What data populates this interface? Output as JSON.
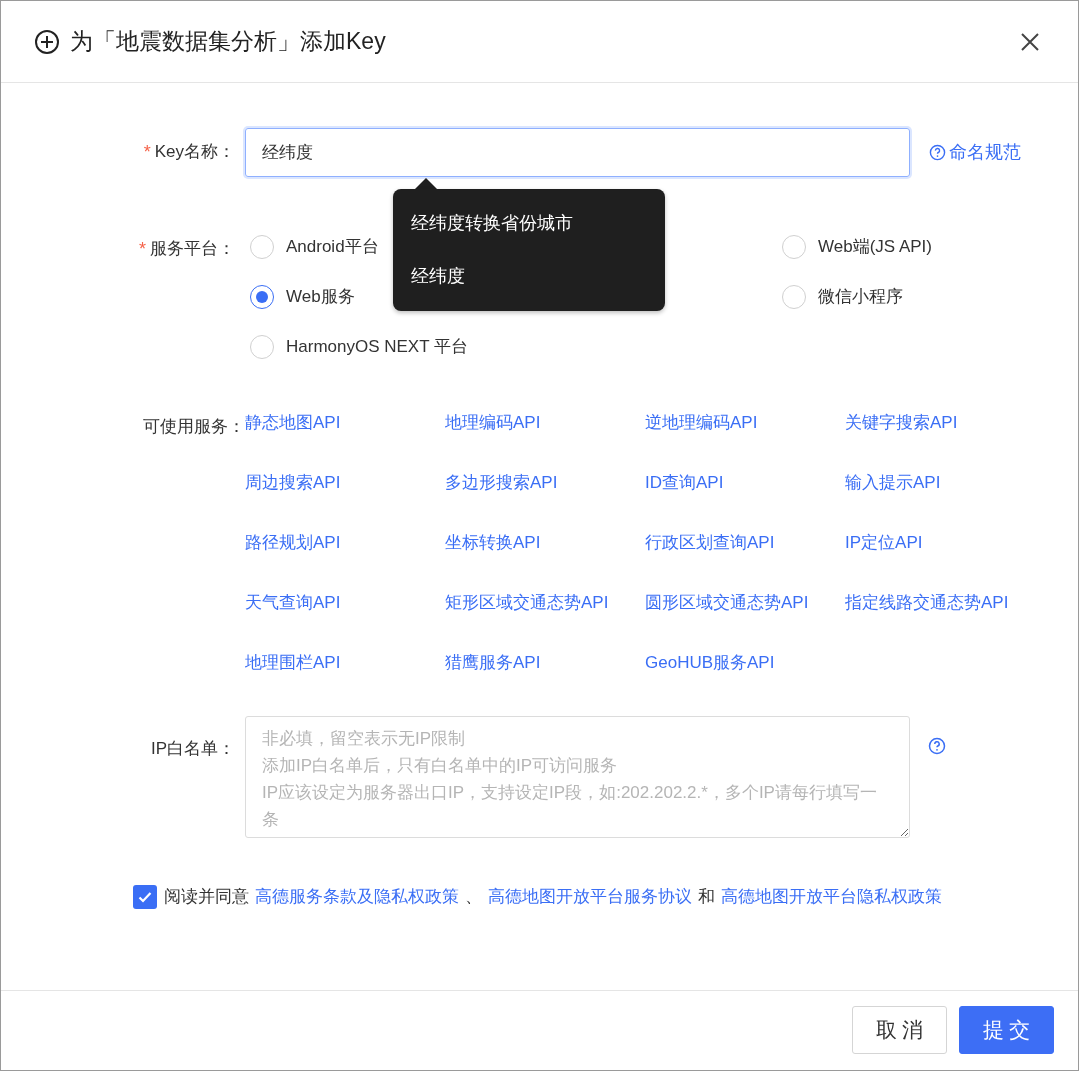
{
  "dialog": {
    "title": "为「地震数据集分析」添加Key"
  },
  "key_name": {
    "label": "Key名称：",
    "required_mark": "*",
    "value": "经纬度",
    "help_link": "命名规范"
  },
  "suggestions": [
    {
      "text": "经纬度转换省份城市"
    },
    {
      "text": "经纬度"
    }
  ],
  "platform": {
    "label": "服务平台：",
    "required_mark": "*",
    "options": [
      {
        "label": "Android平台",
        "selected": false
      },
      {
        "label": "Web端(JS API)",
        "selected": false
      },
      {
        "label": "Web服务",
        "selected": true
      },
      {
        "label": "微信小程序",
        "selected": false
      },
      {
        "label": "HarmonyOS NEXT 平台",
        "selected": false
      }
    ]
  },
  "services": {
    "label": "可使用服务：",
    "items": [
      "静态地图API",
      "地理编码API",
      "逆地理编码API",
      "关键字搜索API",
      "周边搜索API",
      "多边形搜索API",
      "ID查询API",
      "输入提示API",
      "路径规划API",
      "坐标转换API",
      "行政区划查询API",
      "IP定位API",
      "天气查询API",
      "矩形区域交通态势API",
      "圆形区域交通态势API",
      "指定线路交通态势API",
      "地理围栏API",
      "猎鹰服务API",
      "GeoHUB服务API"
    ]
  },
  "ip_whitelist": {
    "label": "IP白名单：",
    "placeholder_lines": [
      "非必填，留空表示无IP限制",
      "添加IP白名单后，只有白名单中的IP可访问服务",
      "IP应该设定为服务器出口IP，支持设定IP段，如:202.202.2.*，多个IP请每行填写一条"
    ]
  },
  "agreement": {
    "checked": true,
    "text": "阅读并同意",
    "links": [
      "高德服务条款及隐私权政策",
      "高德地图开放平台服务协议",
      "高德地图开放平台隐私权政策"
    ],
    "separators": [
      "、",
      "和"
    ]
  },
  "buttons": [
    {
      "label": "取 消",
      "kind": "secondary"
    },
    {
      "label": "提 交",
      "kind": "primary"
    }
  ]
}
